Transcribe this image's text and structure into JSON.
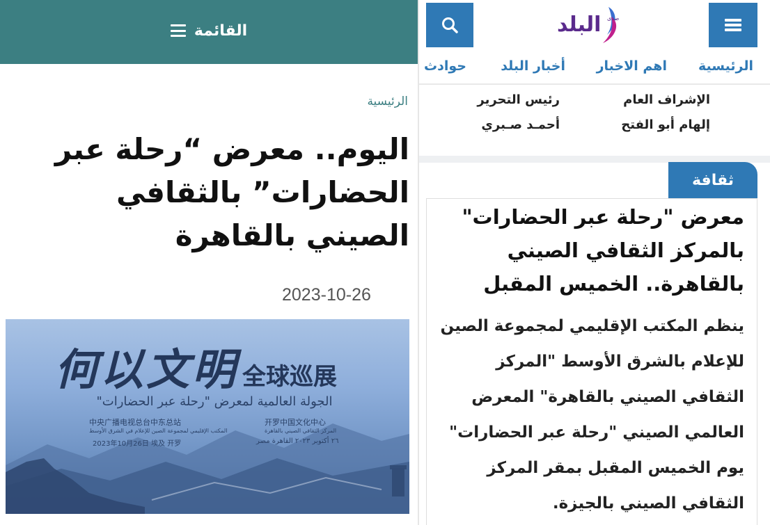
{
  "left": {
    "header": {
      "menu_label": "القائمة",
      "bg_color": "#3c7f82"
    },
    "breadcrumb": "الرئيسية",
    "title": "اليوم.. معرض “رحلة عبر الحضارات” بالثقافي الصيني بالقاهرة",
    "date": "2023-10-26",
    "hero": {
      "cn_big": "何以文明",
      "cn_small": "全球巡展",
      "ar_subtitle": "الجولة العالمية لمعرض \"رحلة عبر الحضارات\"",
      "org_left": "中央广播电视总台中东总站",
      "org_left_sub": "المكتب الإقليمي لمجموعة الصين للإعلام في الشرق الأوسط",
      "org_right": "开罗中国文化中心",
      "org_right_sub": "المركز الثقافي الصيني بالقاهرة",
      "date_left": "2023年10月26日  埃及 开罗",
      "date_right": "٢٦ أكتوبر ٢٠٢٣ القاهرة مصر"
    }
  },
  "right": {
    "logo": {
      "text": "البلد",
      "small": "صدى",
      "color": "#5a2a8c"
    },
    "nav": [
      "الرئيسية",
      "اهم الاخبار",
      "أخبار البلد",
      "حوادث"
    ],
    "staff": {
      "supervisor_label": "الإشراف العام",
      "supervisor_name": "إلهام أبو الفتح",
      "editor_label": "رئيس التحرير",
      "editor_name": "أحمـد صـبري"
    },
    "category": "ثقافة",
    "article_title": "معرض \"رحلة عبر الحضارات\" بالمركز الثقافي الصيني بالقاهرة.. الخميس المقبل",
    "article_body": "ينظم المكتب الإقليمي لمجموعة الصين للإعلام بالشرق الأوسط \"المركز الثقافي الصيني بالقاهرة\" المعرض العالمي الصيني \"رحلة عبر الحضارات\" يوم الخميس المقبل بمقر المركز الثقافي الصيني بالجيزة.",
    "accent_color": "#2f79b5"
  },
  "icons": {
    "search": "search-icon",
    "menu": "hamburger-icon"
  }
}
